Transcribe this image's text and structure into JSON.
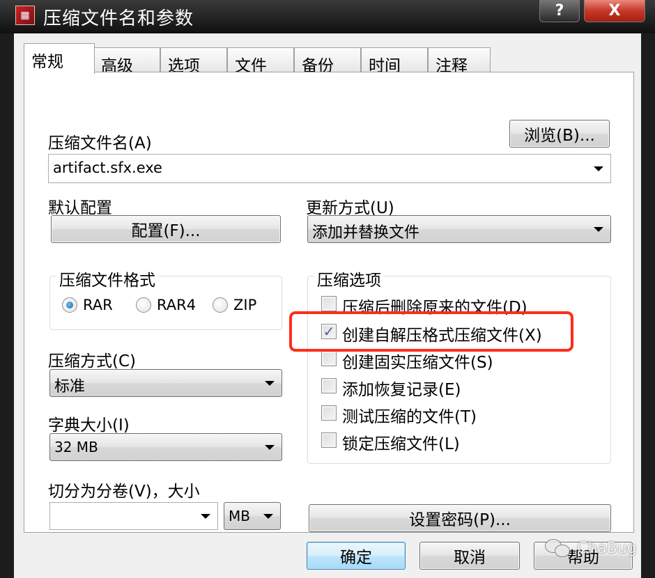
{
  "window": {
    "title": "压缩文件名和参数",
    "help_symbol": "?",
    "close_symbol": "X"
  },
  "tabs": [
    {
      "label": "常规",
      "active": true
    },
    {
      "label": "高级",
      "active": false
    },
    {
      "label": "选项",
      "active": false
    },
    {
      "label": "文件",
      "active": false
    },
    {
      "label": "备份",
      "active": false
    },
    {
      "label": "时间",
      "active": false
    },
    {
      "label": "注释",
      "active": false
    }
  ],
  "archive_name": {
    "label": "压缩文件名(A)",
    "value": "artifact.sfx.exe",
    "browse_label": "浏览(B)..."
  },
  "default_profile": {
    "label": "默认配置",
    "button_label": "配置(F)..."
  },
  "update_mode": {
    "label": "更新方式(U)",
    "value": "添加并替换文件"
  },
  "archive_format": {
    "title": "压缩文件格式",
    "options": [
      {
        "label": "RAR",
        "checked": true
      },
      {
        "label": "RAR4",
        "checked": false
      },
      {
        "label": "ZIP",
        "checked": false
      }
    ]
  },
  "compression_method": {
    "label": "压缩方式(C)",
    "value": "标准"
  },
  "dictionary_size": {
    "label": "字典大小(I)",
    "value": "32 MB"
  },
  "split_volumes": {
    "label": "切分为分卷(V)，大小",
    "value": "",
    "unit": "MB"
  },
  "archive_options": {
    "title": "压缩选项",
    "items": [
      {
        "label": "压缩后删除原来的文件(D)",
        "checked": false
      },
      {
        "label": "创建自解压格式压缩文件(X)",
        "checked": true
      },
      {
        "label": "创建固实压缩文件(S)",
        "checked": false
      },
      {
        "label": "添加恢复记录(E)",
        "checked": false
      },
      {
        "label": "测试压缩的文件(T)",
        "checked": false
      },
      {
        "label": "锁定压缩文件(L)",
        "checked": false
      }
    ]
  },
  "set_password": {
    "label": "设置密码(P)..."
  },
  "footer": {
    "ok_label": "确定",
    "cancel_label": "取消",
    "help_label": "帮助"
  },
  "watermark": {
    "text": "ChaBug"
  },
  "colors": {
    "highlight": "#ff2c1a",
    "accent": "#1b5e9e",
    "check": "#4a5f97"
  },
  "icons": {
    "app": "winrar-icon",
    "check": "✓"
  }
}
